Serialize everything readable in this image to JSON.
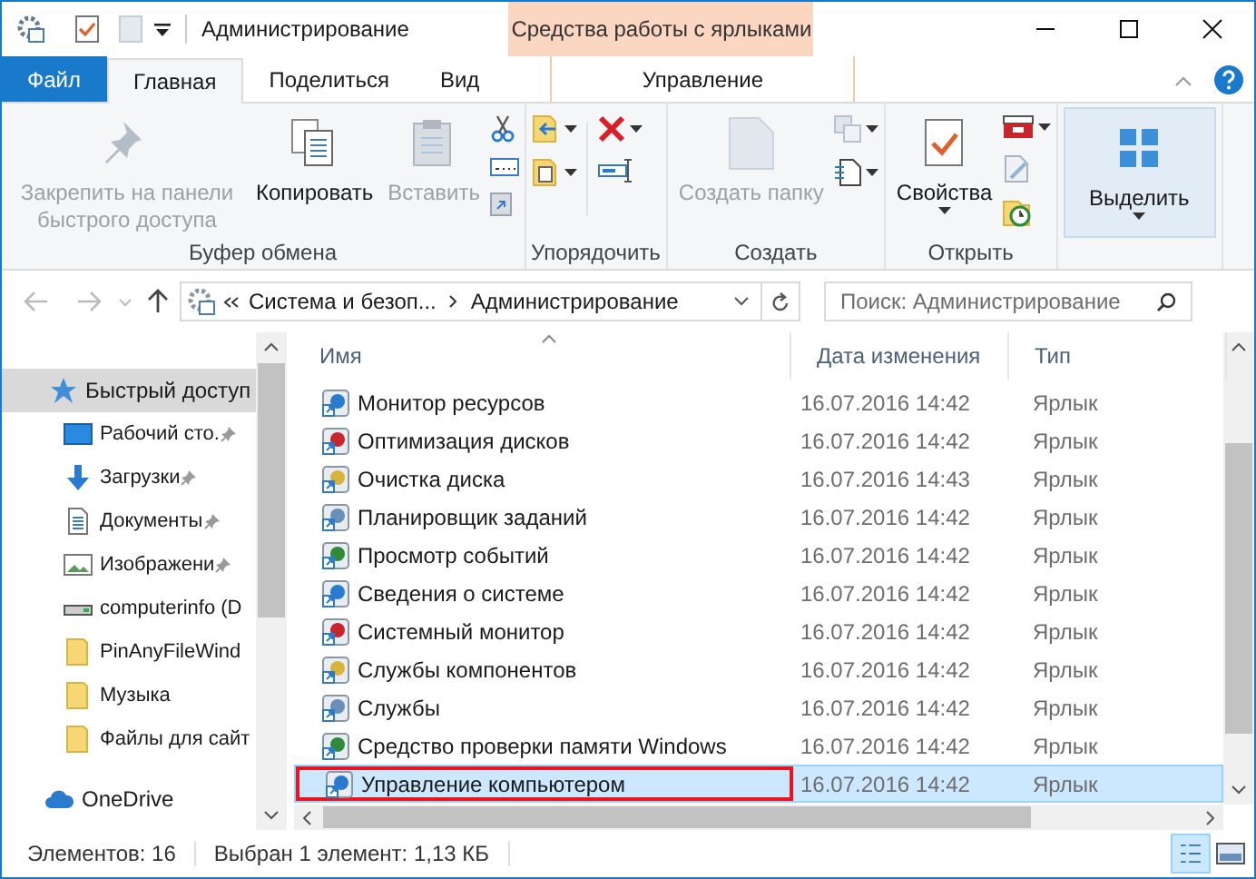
{
  "window": {
    "title": "Администрирование",
    "context_tab_group": "Средства работы с ярлыками"
  },
  "tabs": [
    {
      "label": "Файл",
      "kind": "file",
      "selected": false
    },
    {
      "label": "Главная",
      "kind": "tab",
      "selected": true
    },
    {
      "label": "Поделиться",
      "kind": "tab",
      "selected": false
    },
    {
      "label": "Вид",
      "kind": "tab",
      "selected": false
    },
    {
      "label": "Управление",
      "kind": "context",
      "selected": false
    }
  ],
  "ribbon_groups": [
    {
      "label": "Буфер обмена",
      "buttons": [
        {
          "kind": "pin",
          "label": "Закрепить на панели быстрого доступа",
          "disabled": true
        },
        {
          "kind": "copy",
          "label": "Копировать",
          "disabled": false
        },
        {
          "kind": "paste",
          "label": "Вставить",
          "disabled": true
        },
        {
          "kind": "clipsmall"
        }
      ]
    },
    {
      "label": "Упорядочить",
      "buttons": [
        {
          "kind": "organize"
        }
      ]
    },
    {
      "label": "Создать",
      "buttons": [
        {
          "kind": "newfolder",
          "label": "Создать папку",
          "disabled": true
        },
        {
          "kind": "newsmall"
        }
      ]
    },
    {
      "label": "Открыть",
      "buttons": [
        {
          "kind": "props",
          "label": "Свойства",
          "disabled": false
        },
        {
          "kind": "opensmall"
        }
      ]
    },
    {
      "buttons": [
        {
          "kind": "select",
          "label": "Выделить",
          "disabled": false
        }
      ]
    }
  ],
  "address": {
    "parent": "Система и безоп...",
    "current": "Администрирование"
  },
  "search": {
    "placeholder": "Поиск: Администрирование"
  },
  "sidebar": {
    "items": [
      {
        "label": "Быстрый доступ",
        "kind": "star",
        "selected": true,
        "pinned": false
      },
      {
        "label": "Рабочий сто.",
        "kind": "desktop",
        "selected": false,
        "pinned": true
      },
      {
        "label": "Загрузки",
        "kind": "download",
        "selected": false,
        "pinned": true
      },
      {
        "label": "Документы",
        "kind": "docs",
        "selected": false,
        "pinned": true
      },
      {
        "label": "Изображени",
        "kind": "images",
        "selected": false,
        "pinned": true
      },
      {
        "label": "computerinfo (D",
        "kind": "drive",
        "selected": false,
        "pinned": false
      },
      {
        "label": "PinAnyFileWind",
        "kind": "folder",
        "selected": false,
        "pinned": false
      },
      {
        "label": "Музыка",
        "kind": "folder",
        "selected": false,
        "pinned": false
      },
      {
        "label": "Файлы для сайт",
        "kind": "folder",
        "selected": false,
        "pinned": false
      },
      {
        "label": "OneDrive",
        "kind": "cloud",
        "selected": false,
        "pinned": false
      }
    ]
  },
  "table": {
    "columns": [
      "Имя",
      "Дата изменения",
      "Тип"
    ],
    "rows": [
      {
        "name": "Монитор ресурсов",
        "date": "16.07.2016 14:42",
        "type": "Ярлык",
        "selected": false,
        "outlined": false
      },
      {
        "name": "Оптимизация дисков",
        "date": "16.07.2016 14:42",
        "type": "Ярлык",
        "selected": false,
        "outlined": false
      },
      {
        "name": "Очистка диска",
        "date": "16.07.2016 14:43",
        "type": "Ярлык",
        "selected": false,
        "outlined": false
      },
      {
        "name": "Планировщик заданий",
        "date": "16.07.2016 14:42",
        "type": "Ярлык",
        "selected": false,
        "outlined": false
      },
      {
        "name": "Просмотр событий",
        "date": "16.07.2016 14:42",
        "type": "Ярлык",
        "selected": false,
        "outlined": false
      },
      {
        "name": "Сведения о системе",
        "date": "16.07.2016 14:42",
        "type": "Ярлык",
        "selected": false,
        "outlined": false
      },
      {
        "name": "Системный монитор",
        "date": "16.07.2016 14:42",
        "type": "Ярлык",
        "selected": false,
        "outlined": false
      },
      {
        "name": "Службы компонентов",
        "date": "16.07.2016 14:42",
        "type": "Ярлык",
        "selected": false,
        "outlined": false
      },
      {
        "name": "Службы",
        "date": "16.07.2016 14:42",
        "type": "Ярлык",
        "selected": false,
        "outlined": false
      },
      {
        "name": "Средство проверки памяти Windows",
        "date": "16.07.2016 14:42",
        "type": "Ярлык",
        "selected": false,
        "outlined": false
      },
      {
        "name": "Управление компьютером",
        "date": "16.07.2016 14:42",
        "type": "Ярлык",
        "selected": true,
        "outlined": true
      }
    ]
  },
  "status_bar": {
    "count": "Элементов: 16",
    "selection": "Выбран 1 элемент: 1,13 КБ"
  }
}
